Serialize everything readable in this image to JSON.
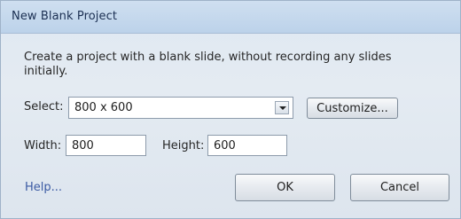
{
  "dialog": {
    "title": "New Blank Project",
    "description": "Create a project with a blank slide, without recording any slides initially.",
    "select_label": "Select:",
    "select_value": "800 x 600",
    "customize_label": "Customize...",
    "width_label": "Width:",
    "width_value": "800",
    "height_label": "Height:",
    "height_value": "600",
    "help_label": "Help...",
    "ok_label": "OK",
    "cancel_label": "Cancel"
  }
}
